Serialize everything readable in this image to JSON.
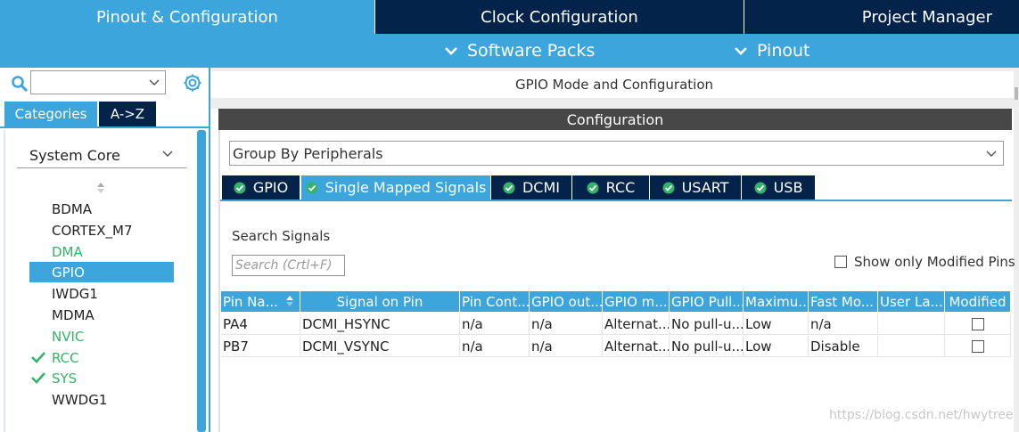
{
  "top_tabs": {
    "pinout": "Pinout & Configuration",
    "clock": "Clock Configuration",
    "project": "Project Manager"
  },
  "sub_menu": {
    "software_packs": "Software Packs",
    "pinout": "Pinout"
  },
  "left_panel": {
    "search_value": "",
    "tabs": {
      "categories": "Categories",
      "az": "A->Z"
    },
    "group": "System Core",
    "items": [
      {
        "label": "BDMA",
        "state": "normal"
      },
      {
        "label": "CORTEX_M7",
        "state": "normal"
      },
      {
        "label": "DMA",
        "state": "green"
      },
      {
        "label": "GPIO",
        "state": "selected"
      },
      {
        "label": "IWDG1",
        "state": "normal"
      },
      {
        "label": "MDMA",
        "state": "normal"
      },
      {
        "label": "NVIC",
        "state": "green"
      },
      {
        "label": "RCC",
        "state": "checked"
      },
      {
        "label": "SYS",
        "state": "checked"
      },
      {
        "label": "WWDG1",
        "state": "normal"
      }
    ]
  },
  "main": {
    "header": "GPIO Mode and Configuration",
    "config_title": "Configuration",
    "group_by": "Group By Peripherals",
    "peripheral_tabs": [
      {
        "label": "GPIO",
        "active": false
      },
      {
        "label": "Single Mapped Signals",
        "active": true
      },
      {
        "label": "DCMI",
        "active": false
      },
      {
        "label": "RCC",
        "active": false
      },
      {
        "label": "USART",
        "active": false
      },
      {
        "label": "USB",
        "active": false
      }
    ],
    "search_label": "Search Signals",
    "search_placeholder": "Search (Crtl+F)",
    "show_modified_label": "Show only Modified Pins",
    "table": {
      "headers": [
        "Pin Na...",
        "Signal on Pin",
        "Pin Cont...",
        "GPIO out...",
        "GPIO m...",
        "GPIO Pull...",
        "Maximu...",
        "Fast Mo...",
        "User La...",
        "Modified"
      ],
      "rows": [
        [
          "PA4",
          "DCMI_HSYNC",
          "n/a",
          "n/a",
          "Alternat...",
          "No pull-u...",
          "Low",
          "n/a",
          "",
          ""
        ],
        [
          "PB7",
          "DCMI_VSYNC",
          "n/a",
          "n/a",
          "Alternat...",
          "No pull-u...",
          "Low",
          "Disable",
          "",
          ""
        ]
      ]
    }
  },
  "watermark": "https://blog.csdn.net/hwytree",
  "colors": {
    "accent": "#3ca5dc",
    "navy": "#03234b",
    "dark_bar": "#474747",
    "green": "#34b36b"
  }
}
